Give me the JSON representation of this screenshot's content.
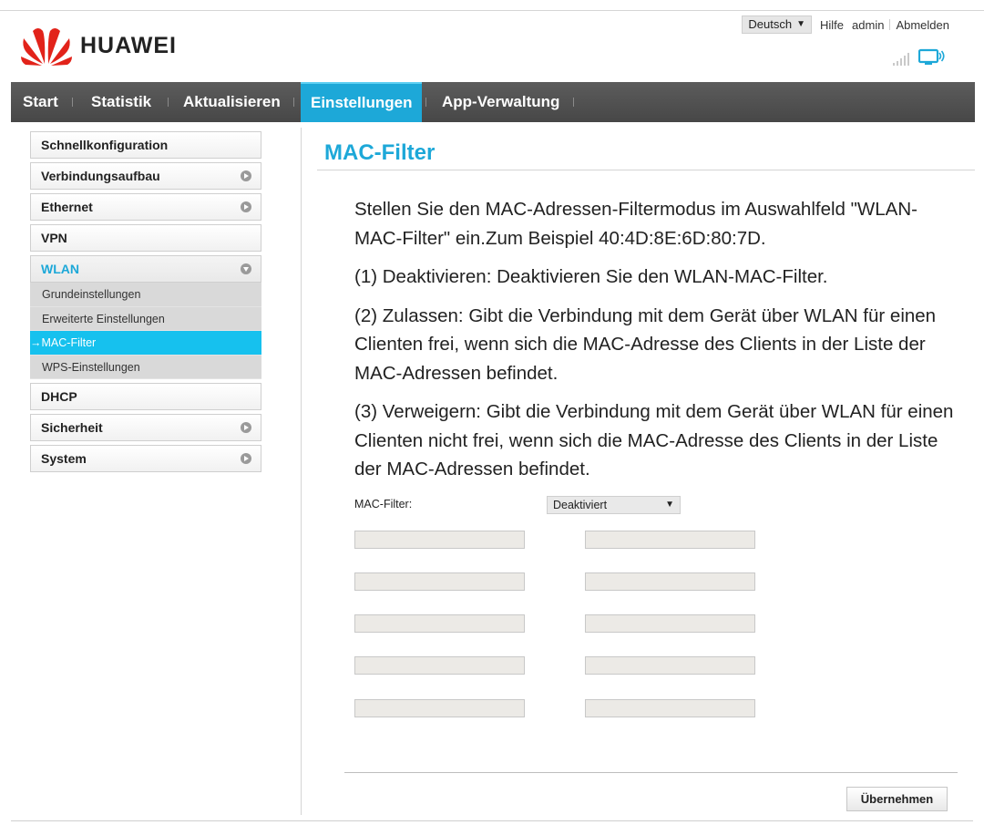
{
  "brand": {
    "name": "HUAWEI",
    "accent": "#1da8d8",
    "logo_color": "#e2231a"
  },
  "header": {
    "language": "Deutsch",
    "links": [
      "Hilfe",
      "admin",
      "Abmelden"
    ],
    "status_icons": [
      "signal-strength-icon",
      "connection-monitor-icon"
    ]
  },
  "nav": {
    "items": [
      {
        "label": "Start"
      },
      {
        "label": "Statistik"
      },
      {
        "label": "Aktualisieren"
      },
      {
        "label": "Einstellungen",
        "active": true
      },
      {
        "label": "App-Verwaltung"
      }
    ]
  },
  "sidebar": {
    "items": [
      {
        "label": "Schnellkonfiguration"
      },
      {
        "label": "Verbindungsaufbau",
        "arrow": "right"
      },
      {
        "label": "Ethernet",
        "arrow": "right"
      },
      {
        "label": "VPN"
      },
      {
        "label": "WLAN",
        "arrow": "down",
        "open": true
      },
      {
        "label": "DHCP"
      },
      {
        "label": "Sicherheit",
        "arrow": "right"
      },
      {
        "label": "System",
        "arrow": "right"
      }
    ],
    "wlan_subitems": [
      {
        "label": "Grundeinstellungen"
      },
      {
        "label": "Erweiterte Einstellungen"
      },
      {
        "label": "→MAC-Filter",
        "active": true
      },
      {
        "label": "WPS-Einstellungen"
      }
    ]
  },
  "main": {
    "title": "MAC-Filter",
    "description": [
      "Stellen Sie den MAC-Adressen-Filtermodus im Auswahlfeld \"WLAN-MAC-Filter\" ein.Zum Beispiel 40:4D:8E:6D:80:7D.",
      "(1) Deaktivieren: Deaktivieren Sie den WLAN-MAC-Filter.",
      "(2) Zulassen: Gibt die Verbindung mit dem Gerät über WLAN für einen Clienten frei, wenn sich die MAC-Adresse des Clients in der Liste der MAC-Adressen befindet.",
      "(3) Verweigern: Gibt die Verbindung mit dem Gerät über WLAN für einen Clienten nicht frei, wenn sich die MAC-Adresse des Clients in der Liste der MAC-Adressen befindet."
    ],
    "filter_label": "MAC-Filter:",
    "filter_value": "Deaktiviert",
    "mac_fields": [
      "",
      "",
      "",
      "",
      "",
      "",
      "",
      "",
      "",
      ""
    ],
    "apply_label": "Übernehmen"
  }
}
